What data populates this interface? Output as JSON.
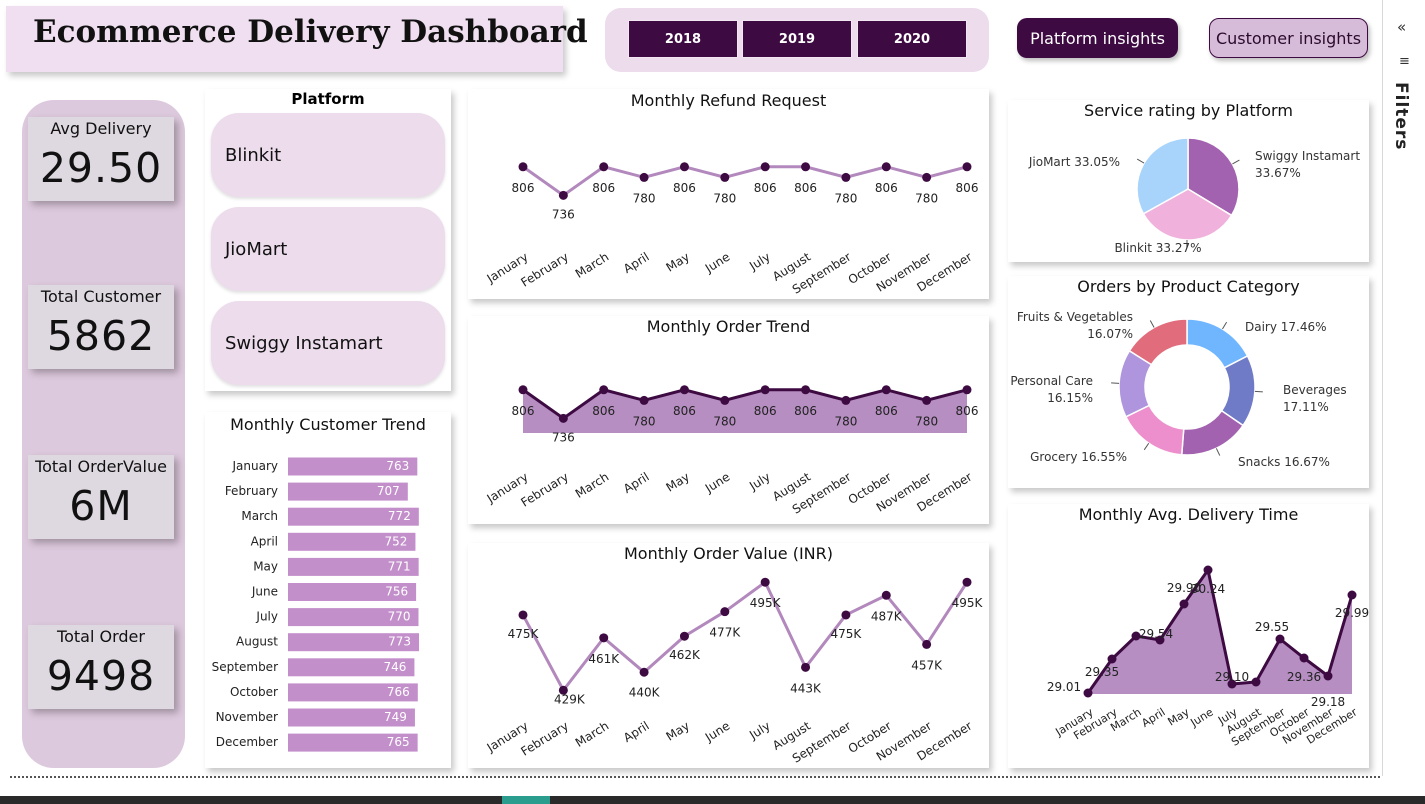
{
  "header": {
    "title": "Ecommerce Delivery Dashboard",
    "years": [
      "2018",
      "2019",
      "2020"
    ],
    "nav": {
      "platform": "Platform insights",
      "customer": "Customer insights"
    },
    "filters_label": "Filters"
  },
  "kpis": [
    {
      "label": "Avg Delivery",
      "value": "29.50"
    },
    {
      "label": "Total Customer",
      "value": "5862"
    },
    {
      "label": "Total OrderValue",
      "value": "6M"
    },
    {
      "label": "Total Order",
      "value": "9498"
    }
  ],
  "platform": {
    "title": "Platform",
    "items": [
      "Blinkit",
      "JioMart",
      "Swiggy Instamart"
    ]
  },
  "months": [
    "January",
    "February",
    "March",
    "April",
    "May",
    "June",
    "July",
    "August",
    "September",
    "October",
    "November",
    "December"
  ],
  "colors": {
    "dark": "#3d0a42",
    "line_light": "#b288bd",
    "bar": "#c38fcb",
    "area": "#b68ec2"
  },
  "chart_data": [
    {
      "id": "refund",
      "type": "line",
      "title": "Monthly Refund Request",
      "categories": [
        "January",
        "February",
        "March",
        "April",
        "May",
        "June",
        "July",
        "August",
        "September",
        "October",
        "November",
        "December"
      ],
      "values": [
        806,
        736,
        806,
        780,
        806,
        780,
        806,
        806,
        780,
        806,
        780,
        806
      ],
      "labels": [
        "806",
        "736",
        "806",
        "780",
        "806",
        "780",
        "806",
        "806",
        "780",
        "806",
        "780",
        "806"
      ],
      "ylim": [
        700,
        830
      ]
    },
    {
      "id": "order_trend",
      "type": "area",
      "title": "Monthly Order Trend",
      "categories": [
        "January",
        "February",
        "March",
        "April",
        "May",
        "June",
        "July",
        "August",
        "September",
        "October",
        "November",
        "December"
      ],
      "values": [
        806,
        736,
        806,
        780,
        806,
        780,
        806,
        806,
        780,
        806,
        780,
        806
      ],
      "labels": [
        "806",
        "736",
        "806",
        "780",
        "806",
        "780",
        "806",
        "806",
        "780",
        "806",
        "780",
        "806"
      ],
      "ylim": [
        700,
        830
      ]
    },
    {
      "id": "order_value",
      "type": "line",
      "title": "Monthly Order Value (INR)",
      "categories": [
        "January",
        "February",
        "March",
        "April",
        "May",
        "June",
        "July",
        "August",
        "September",
        "October",
        "November",
        "December"
      ],
      "values": [
        475,
        429,
        461,
        440,
        462,
        477,
        495,
        443,
        475,
        487,
        457,
        495
      ],
      "labels": [
        "475K",
        "429K",
        "461K",
        "440K",
        "462K",
        "477K",
        "495K",
        "443K",
        "475K",
        "487K",
        "457K",
        "495K"
      ],
      "ylim": [
        420,
        500
      ]
    },
    {
      "id": "customer_trend",
      "type": "bar",
      "title": "Monthly Customer Trend",
      "categories": [
        "January",
        "February",
        "March",
        "April",
        "May",
        "June",
        "July",
        "August",
        "September",
        "October",
        "November",
        "December"
      ],
      "values": [
        763,
        707,
        772,
        752,
        771,
        756,
        770,
        773,
        746,
        766,
        749,
        765
      ]
    },
    {
      "id": "service_rating",
      "type": "pie",
      "title": "Service rating by Platform",
      "slices": [
        {
          "name": "Swiggy Instamart",
          "value": 33.67,
          "label_pct": "33.67%",
          "color": "#a362b0"
        },
        {
          "name": "Blinkit",
          "value": 33.27,
          "label_pct": "33.27%",
          "color": "#f0b2dc"
        },
        {
          "name": "JioMart",
          "value": 33.05,
          "label_pct": "33.05%",
          "color": "#a8d4fb"
        }
      ]
    },
    {
      "id": "product_category",
      "type": "pie",
      "title": "Orders by Product Category",
      "slices": [
        {
          "name": "Dairy",
          "value": 17.46,
          "label_pct": "17.46%",
          "color": "#6fb6ff"
        },
        {
          "name": "Beverages",
          "value": 17.11,
          "label_pct": "17.11%",
          "color": "#6f7bc6"
        },
        {
          "name": "Snacks",
          "value": 16.67,
          "label_pct": "16.67%",
          "color": "#a362b0"
        },
        {
          "name": "Grocery",
          "value": 16.55,
          "label_pct": "16.55%",
          "color": "#ee8fcd"
        },
        {
          "name": "Personal Care",
          "value": 16.15,
          "label_pct": "16.15%",
          "color": "#ae95dd"
        },
        {
          "name": "Fruits & Vegetables",
          "value": 16.07,
          "label_pct": "16.07%",
          "color": "#e06c7c"
        }
      ]
    },
    {
      "id": "delivery_time",
      "type": "area",
      "title": "Monthly Avg. Delivery Time",
      "categories": [
        "January",
        "February",
        "March",
        "April",
        "May",
        "June",
        "July",
        "August",
        "September",
        "October",
        "November",
        "December"
      ],
      "values": [
        29.01,
        29.35,
        29.58,
        29.54,
        29.9,
        30.24,
        29.1,
        29.12,
        29.55,
        29.36,
        29.18,
        29.99
      ],
      "labels": [
        "29.01",
        "29.35",
        "",
        "29.54",
        "29.90",
        "30.24",
        "29.10",
        "",
        "29.55",
        "29.36",
        "29.18",
        "29.99"
      ],
      "ylim": [
        29.0,
        30.3
      ]
    }
  ]
}
